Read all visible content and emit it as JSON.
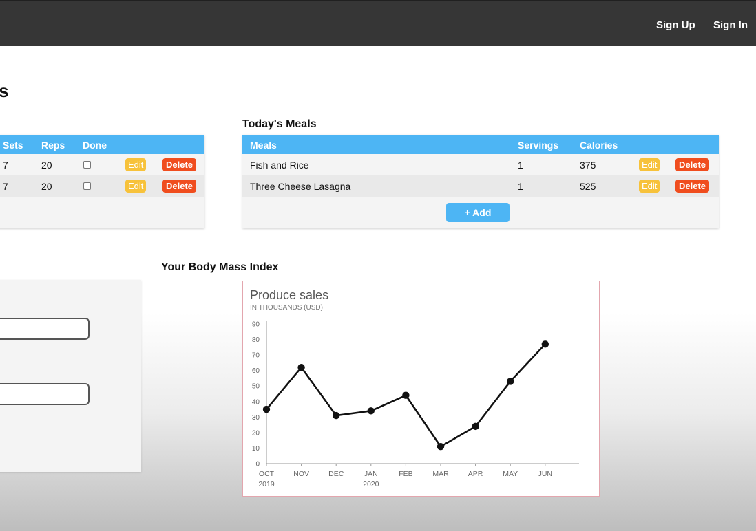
{
  "header": {
    "sign_up": "Sign Up",
    "sign_in": "Sign In"
  },
  "page": {
    "title_fragment": "s"
  },
  "workouts": {
    "columns": [
      "Sets",
      "Reps",
      "Done"
    ],
    "rows": [
      {
        "sets": "7",
        "reps": "20",
        "done": false,
        "edit": "Edit",
        "delete": "Delete"
      },
      {
        "sets": "7",
        "reps": "20",
        "done": false,
        "edit": "Edit",
        "delete": "Delete"
      }
    ]
  },
  "meals": {
    "title": "Today's Meals",
    "columns": [
      "Meals",
      "Servings",
      "Calories"
    ],
    "rows": [
      {
        "meal": "Fish and Rice",
        "servings": "1",
        "calories": "375",
        "edit": "Edit",
        "delete": "Delete"
      },
      {
        "meal": "Three Cheese Lasagna",
        "servings": "1",
        "calories": "525",
        "edit": "Edit",
        "delete": "Delete"
      }
    ],
    "add_label": "+ Add"
  },
  "bmi": {
    "title": "Your Body Mass Index"
  },
  "colors": {
    "header_bg": "#363636",
    "table_header": "#4db5f4",
    "edit_button": "#f7c23b",
    "delete_button": "#f04d1e",
    "chart_border": "#e3a6ae"
  },
  "chart_data": {
    "type": "line",
    "title": "Produce sales",
    "subtitle": "IN THOUSANDS (USD)",
    "xlabel": "",
    "ylabel": "",
    "x_ticks": [
      {
        "label": "OCT",
        "sub": "2019"
      },
      {
        "label": "NOV",
        "sub": ""
      },
      {
        "label": "DEC",
        "sub": ""
      },
      {
        "label": "JAN",
        "sub": "2020"
      },
      {
        "label": "FEB",
        "sub": ""
      },
      {
        "label": "MAR",
        "sub": ""
      },
      {
        "label": "APR",
        "sub": ""
      },
      {
        "label": "MAY",
        "sub": ""
      },
      {
        "label": "JUN",
        "sub": ""
      }
    ],
    "values": [
      35,
      62,
      31,
      34,
      44,
      11,
      24,
      53,
      77
    ],
    "ylim": [
      0,
      90
    ],
    "y_ticks": [
      0,
      10,
      20,
      30,
      40,
      50,
      60,
      70,
      80,
      90
    ],
    "grid": false,
    "line_color": "#111111"
  }
}
